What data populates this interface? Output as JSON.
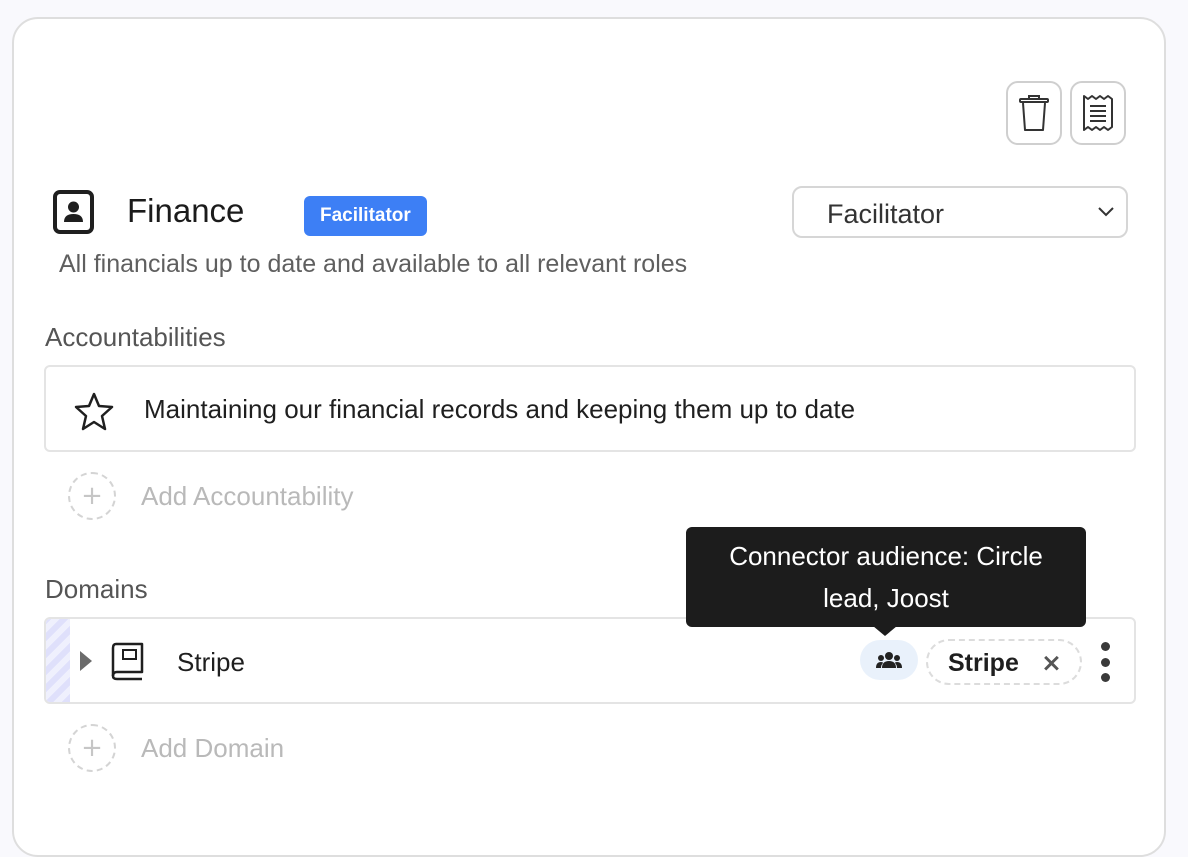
{
  "role": {
    "title": "Finance",
    "badge": "Facilitator",
    "purpose": "All financials up to date and available to all relevant roles",
    "assignment_select": {
      "value": "Facilitator"
    }
  },
  "toolbar": {
    "delete_icon": "trash-icon",
    "notes_icon": "receipt-icon"
  },
  "accountabilities": {
    "label": "Accountabilities",
    "items": [
      {
        "icon": "star-icon",
        "text": "Maintaining our financial records and keeping them up to date"
      }
    ],
    "add_label": "Add Accountability",
    "add_symbol": "+"
  },
  "domains": {
    "label": "Domains",
    "items": [
      {
        "name": "Stripe",
        "icon": "book-icon",
        "connector_chip": "Stripe",
        "chip_remove": "×",
        "audience_icon": "users-icon"
      }
    ],
    "add_label": "Add Domain",
    "add_symbol": "+"
  },
  "tooltip": {
    "text": "Connector audience: Circle lead, Joost"
  },
  "colors": {
    "badge_bg": "#3d7ff5",
    "tooltip_bg": "#1c1c1c",
    "audience_btn_bg": "#e9f1fb",
    "stripe_bar": "#dfe0fb"
  }
}
